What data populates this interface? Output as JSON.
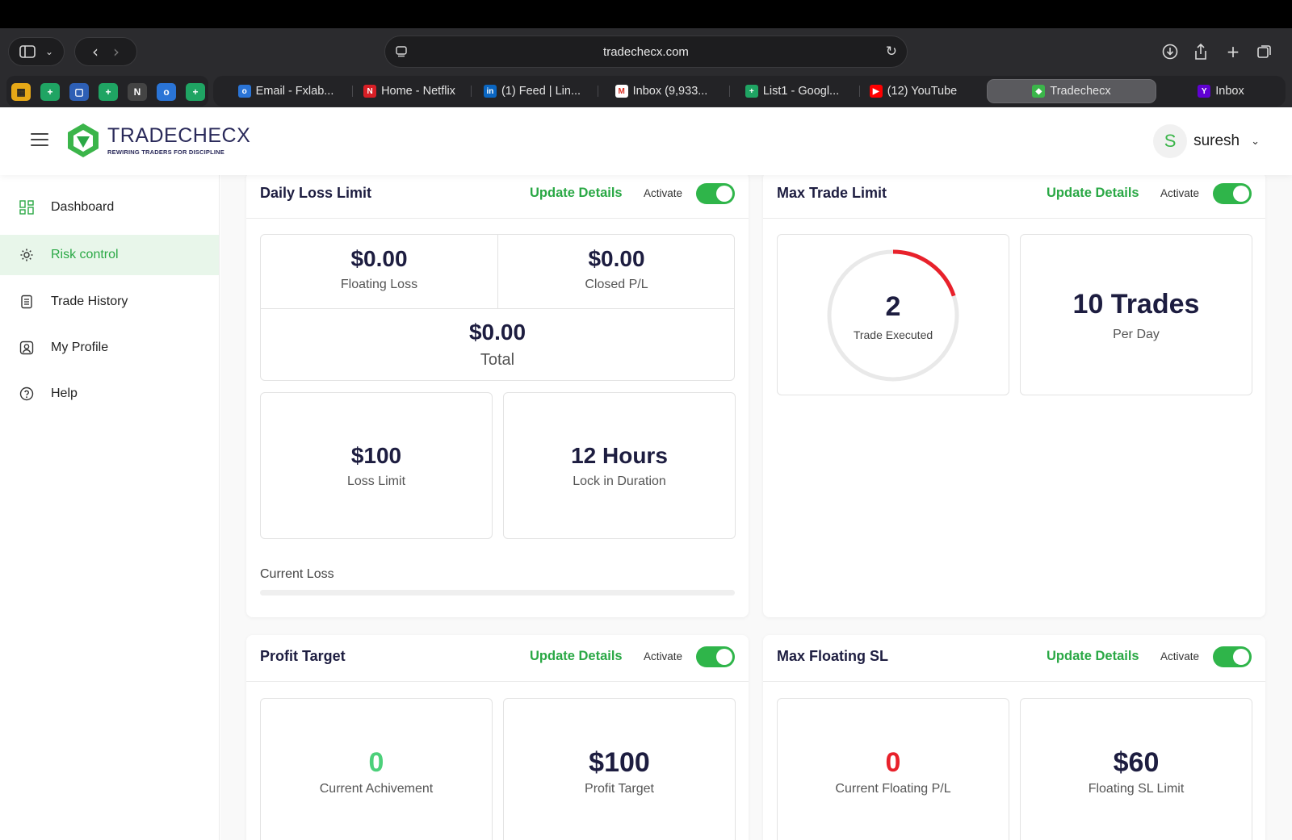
{
  "browser": {
    "url": "tradechecx.com",
    "tabs": [
      {
        "label": "Email - Fxlab...",
        "active": false
      },
      {
        "label": "Home - Netflix",
        "active": false
      },
      {
        "label": "(1) Feed | Lin...",
        "active": false
      },
      {
        "label": "Inbox (9,933...",
        "active": false
      },
      {
        "label": "List1 - Googl...",
        "active": false
      },
      {
        "label": "(12) YouTube",
        "active": false
      },
      {
        "label": "Tradechecx",
        "active": true
      },
      {
        "label": "Inbox",
        "active": false
      }
    ]
  },
  "app": {
    "brand_name": "TRADECHECX",
    "brand_tagline": "REWIRING TRADERS FOR DISCIPLINE",
    "user": {
      "initial": "S",
      "name": "suresh"
    },
    "accent": "#2aa845"
  },
  "sidebar": {
    "items": [
      {
        "label": "Dashboard",
        "icon": "grid-icon",
        "active": false
      },
      {
        "label": "Risk control",
        "icon": "gear-icon",
        "active": true
      },
      {
        "label": "Trade History",
        "icon": "document-icon",
        "active": false
      },
      {
        "label": "My Profile",
        "icon": "profile-icon",
        "active": false
      },
      {
        "label": "Help",
        "icon": "help-icon",
        "active": false
      }
    ]
  },
  "common": {
    "update_label": "Update Details",
    "activate_label": "Activate"
  },
  "daily_loss": {
    "title": "Daily Loss Limit",
    "floating_loss_value": "$0.00",
    "floating_loss_label": "Floating Loss",
    "closed_pl_value": "$0.00",
    "closed_pl_label": "Closed P/L",
    "total_value": "$0.00",
    "total_label": "Total",
    "loss_limit_value": "$100",
    "loss_limit_label": "Loss Limit",
    "lock_value": "12 Hours",
    "lock_label": "Lock in Duration",
    "current_loss_label": "Current Loss",
    "current_loss_fraction": 0
  },
  "max_trade": {
    "title": "Max Trade Limit",
    "executed_value": "2",
    "executed_label": "Trade Executed",
    "executed_fraction": 0.2,
    "limit_value": "10 Trades",
    "limit_label": "Per Day"
  },
  "profit_target": {
    "title": "Profit Target",
    "achievement_value": "0",
    "achievement_label": "Current Achivement",
    "target_value": "$100",
    "target_label": "Profit Target"
  },
  "max_floating_sl": {
    "title": "Max Floating SL",
    "current_value": "0",
    "current_label": "Current Floating P/L",
    "limit_value": "$60",
    "limit_label": "Floating SL Limit"
  }
}
